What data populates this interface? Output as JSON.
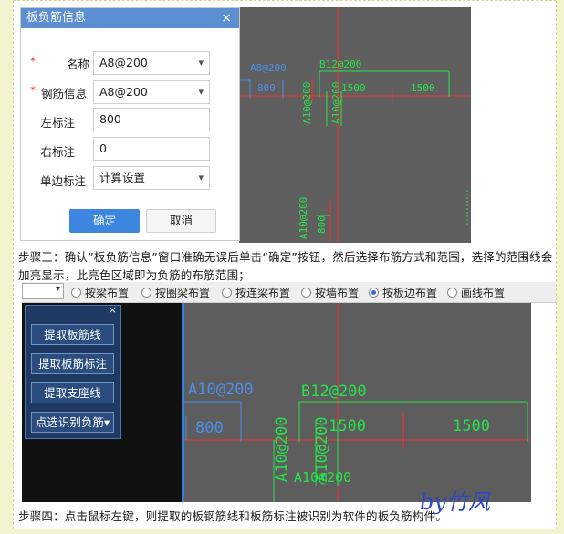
{
  "dialog": {
    "title": "板负筋信息",
    "close": "×",
    "fields": [
      {
        "label": "名称",
        "required": true,
        "value": "A8@200",
        "dropdown": true
      },
      {
        "label": "钢筋信息",
        "required": true,
        "value": "A8@200",
        "dropdown": true
      },
      {
        "label": "左标注",
        "required": false,
        "value": "800",
        "dropdown": false
      },
      {
        "label": "右标注",
        "required": false,
        "value": "0",
        "dropdown": false
      },
      {
        "label": "单边标注",
        "required": false,
        "value": "计算设置",
        "dropdown": true
      }
    ],
    "required_mark": "*",
    "ok_label": "确定",
    "cancel_label": "取消"
  },
  "cad_top": {
    "labels": [
      "A8@200",
      "B12@200",
      "800",
      "1500",
      "1500",
      "A10@200",
      "A10@200",
      "A10@200",
      "800"
    ]
  },
  "step3": "步骤三：确认”板负筋信息”窗口准确无误后单击“确定”按钮，然后选择布筋方式和范围，选择的范围线会加亮显示，此亮色区域即为负筋的布筋范围；",
  "toolbar": {
    "options": [
      "按梁布置",
      "按圈梁布置",
      "按连梁布置",
      "按墙布置",
      "按板边布置",
      "画线布置"
    ],
    "selected_index": 4
  },
  "side_panel": {
    "close": "×",
    "buttons": [
      "提取板筋线",
      "提取板筋标注",
      "提取支座线",
      "点选识别负筋▾"
    ]
  },
  "cad_bottom": {
    "labels": [
      "A10@200",
      "B12@200",
      "800",
      "1500",
      "1500",
      "A10@200",
      "A10@200",
      "A10@200"
    ]
  },
  "step4": "步骤四：点击鼠标左键，则提取的板钢筋线和板筋标注被识别为软件的板负筋构件。",
  "watermark": "by竹风",
  "colors": {
    "accent": "#3c86e0",
    "cad_bg": "#5f5f5f",
    "cad_green": "#27e34a",
    "cad_red": "#ff2b2b",
    "cad_blue": "#4c8ee8"
  }
}
